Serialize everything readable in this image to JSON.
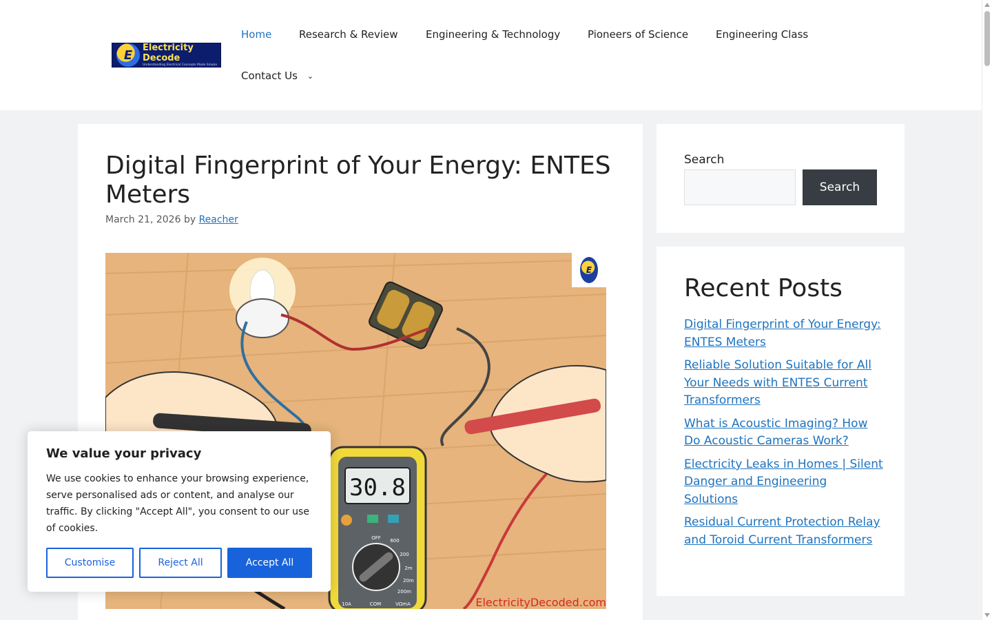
{
  "header": {
    "logo": {
      "title": "Electricity Decode",
      "tagline": "Understanding Electrical Concepts Made Simple",
      "mark": "E"
    },
    "nav": [
      {
        "label": "Home",
        "active": true
      },
      {
        "label": "Research & Review",
        "active": false
      },
      {
        "label": "Engineering & Technology",
        "active": false
      },
      {
        "label": "Pioneers of Science",
        "active": false
      },
      {
        "label": "Engineering Class",
        "active": false
      },
      {
        "label": "Contact Us",
        "active": false,
        "icon": "chevron-down-icon"
      }
    ]
  },
  "article": {
    "title": "Digital Fingerprint of Your Energy: ENTES Meters",
    "date": "March 21, 2026",
    "by": "by",
    "author": "Reacher",
    "image": {
      "meter_reading": "30.8",
      "watermark": "ElectricityDecoded.com",
      "badge_mark": "E",
      "dial_labels": [
        "OFF",
        "600",
        "200",
        "2m",
        "20m",
        "200m",
        "10A",
        "COM",
        "VΩmA"
      ]
    }
  },
  "sidebar": {
    "search": {
      "label": "Search",
      "placeholder": "",
      "button": "Search"
    },
    "recent": {
      "title": "Recent Posts",
      "posts": [
        "Digital Fingerprint of Your Energy: ENTES Meters",
        "Reliable Solution Suitable for All Your Needs with ENTES Current Transformers",
        "What is Acoustic Imaging? How Do Acoustic Cameras Work?",
        "Electricity Leaks in Homes | Silent Danger and Engineering Solutions",
        "Residual Current Protection Relay and Toroid Current Transformers"
      ]
    }
  },
  "cookie": {
    "title": "We value your privacy",
    "text": "We use cookies to enhance your browsing experience, serve personalised ads or content, and analyse our traffic. By clicking \"Accept All\", you consent to our use of cookies.",
    "customise": "Customise",
    "reject": "Reject All",
    "accept": "Accept All"
  },
  "colors": {
    "link": "#1e73be",
    "page_bg": "#f0f2f4",
    "search_button": "#373d42",
    "cookie_accent": "#1863dc",
    "watermark": "#d62828"
  }
}
